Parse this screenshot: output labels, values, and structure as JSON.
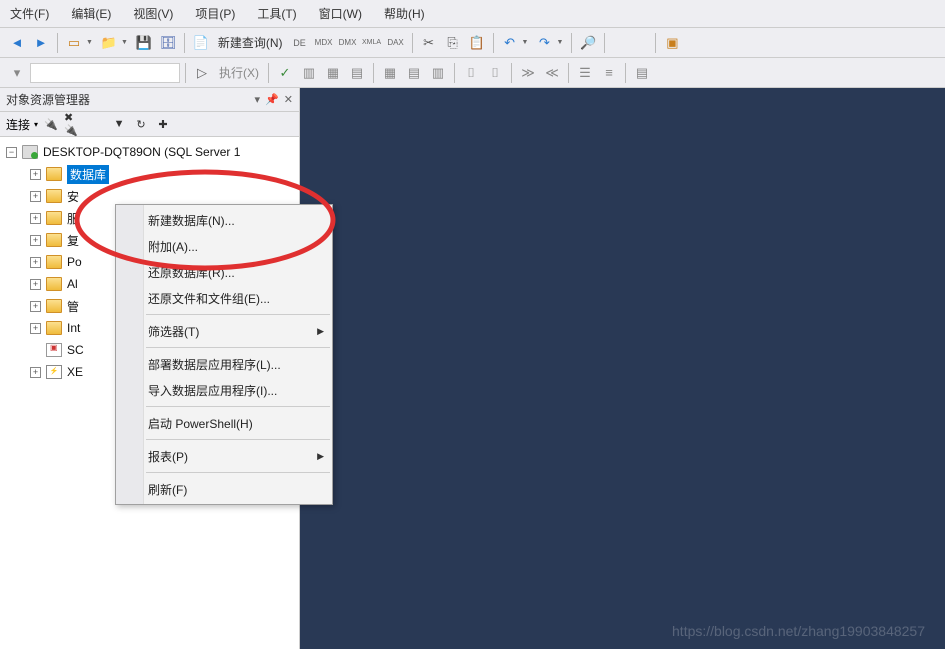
{
  "menu": {
    "file": "文件(F)",
    "edit": "编辑(E)",
    "view": "视图(V)",
    "project": "项目(P)",
    "tools": "工具(T)",
    "window": "窗口(W)",
    "help": "帮助(H)"
  },
  "toolbar": {
    "new_query": "新建查询(N)",
    "execute": "执行(X)"
  },
  "panel": {
    "title": "对象资源管理器",
    "connect": "连接"
  },
  "tree": {
    "server": "DESKTOP-DQT89ON (SQL Server 1",
    "databases": "数据库",
    "security_s": "安",
    "servers_f": "服",
    "replication_f": "复",
    "po": "Po",
    "al": "Al",
    "mgmt_g": "管",
    "int": "Int",
    "agent_sc": "SC",
    "xe": "XE"
  },
  "context_menu": {
    "new_database": "新建数据库(N)...",
    "attach": "附加(A)...",
    "restore_database": "还原数据库(R)...",
    "restore_files": "还原文件和文件组(E)...",
    "filter": "筛选器(T)",
    "deploy_app": "部署数据层应用程序(L)...",
    "import_app": "导入数据层应用程序(I)...",
    "start_powershell": "启动 PowerShell(H)",
    "reports": "报表(P)",
    "refresh": "刷新(F)"
  },
  "watermark": "https://blog.csdn.net/zhang19903848257"
}
